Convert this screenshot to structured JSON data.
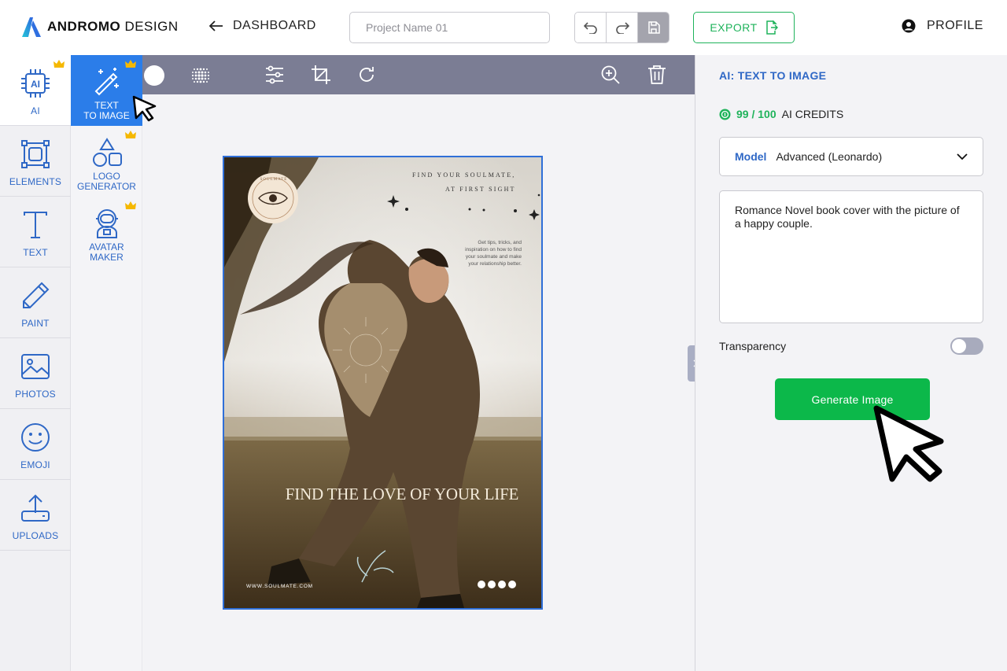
{
  "header": {
    "logo_bold": "ANDROMO",
    "logo_light": " DESIGN",
    "back_label": "DASHBOARD",
    "project_placeholder": "Project Name 01",
    "export_label": "EXPORT",
    "profile_label": "PROFILE"
  },
  "sidebar": {
    "items": [
      {
        "label": "AI",
        "icon": "ai-chip-icon",
        "premium": true
      },
      {
        "label": "ELEMENTS",
        "icon": "elements-icon"
      },
      {
        "label": "TEXT",
        "icon": "text-icon"
      },
      {
        "label": "PAINT",
        "icon": "pencil-icon"
      },
      {
        "label": "PHOTOS",
        "icon": "image-icon"
      },
      {
        "label": "EMOJI",
        "icon": "smiley-icon"
      },
      {
        "label": "UPLOADS",
        "icon": "upload-icon"
      }
    ]
  },
  "subpanel": {
    "items": [
      {
        "label_line1": "TEXT",
        "label_line2": "TO IMAGE",
        "icon": "magic-wand-icon",
        "premium": true
      },
      {
        "label_line1": "LOGO",
        "label_line2": "GENERATOR",
        "icon": "shapes-icon",
        "premium": true
      },
      {
        "label_line1": "AVATAR",
        "label_line2": "MAKER",
        "icon": "astronaut-icon",
        "premium": true
      }
    ]
  },
  "toolbar": {
    "tools": [
      "color-swatch-icon",
      "halftone-icon",
      "adjustments-icon",
      "crop-icon",
      "rotate-icon",
      "zoom-in-icon",
      "trash-icon"
    ]
  },
  "poster": {
    "top_line1": "FIND YOUR SOULMATE,",
    "top_line2": "AT FIRST SIGHT",
    "tips_text": "Get tips, tricks, and inspiration on how to find your soulmate and make your relationship better.",
    "headline": "FIND THE LOVE OF YOUR LIFE",
    "website": "WWW.SOULMATE.COM",
    "badge_text": "SOULMATE"
  },
  "right_panel": {
    "title": "AI: TEXT TO IMAGE",
    "credits_value": "99 / 100",
    "credits_label": "AI CREDITS",
    "model_label": "Model",
    "model_value": "Advanced (Leonardo)",
    "prompt_value": "Romance Novel book cover with the picture of a happy couple.",
    "transparency_label": "Transparency",
    "transparency_on": false,
    "generate_label": "Generate Image"
  },
  "colors": {
    "accent_blue": "#2b7de9",
    "label_blue": "#2f68c6",
    "green": "#0cb84a",
    "toolbar": "#7b7d94",
    "crown": "#f5b800"
  }
}
